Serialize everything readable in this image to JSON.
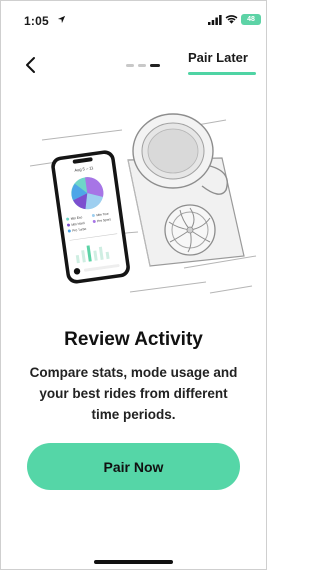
{
  "status_bar": {
    "time": "1:05",
    "battery_level": "48",
    "icons": [
      "location-arrow-icon",
      "signal-icon",
      "wifi-icon",
      "battery-icon"
    ]
  },
  "nav": {
    "back_icon": "chevron-left-icon",
    "pair_later_label": "Pair Later",
    "progress_step": 3,
    "progress_total": 3
  },
  "illustration": {
    "phone_header": "Aug 5 – 11",
    "legend": [
      "Mtn Eco",
      "Mtn Tour",
      "Mtn Hard",
      "Pro Sport",
      "Pro Turbo"
    ]
  },
  "content": {
    "title": "Review Activity",
    "description": "Compare stats, mode usage and your best rides from different time periods."
  },
  "actions": {
    "pair_now_label": "Pair Now"
  },
  "colors": {
    "accent": "#55d6a7",
    "text": "#111111"
  }
}
